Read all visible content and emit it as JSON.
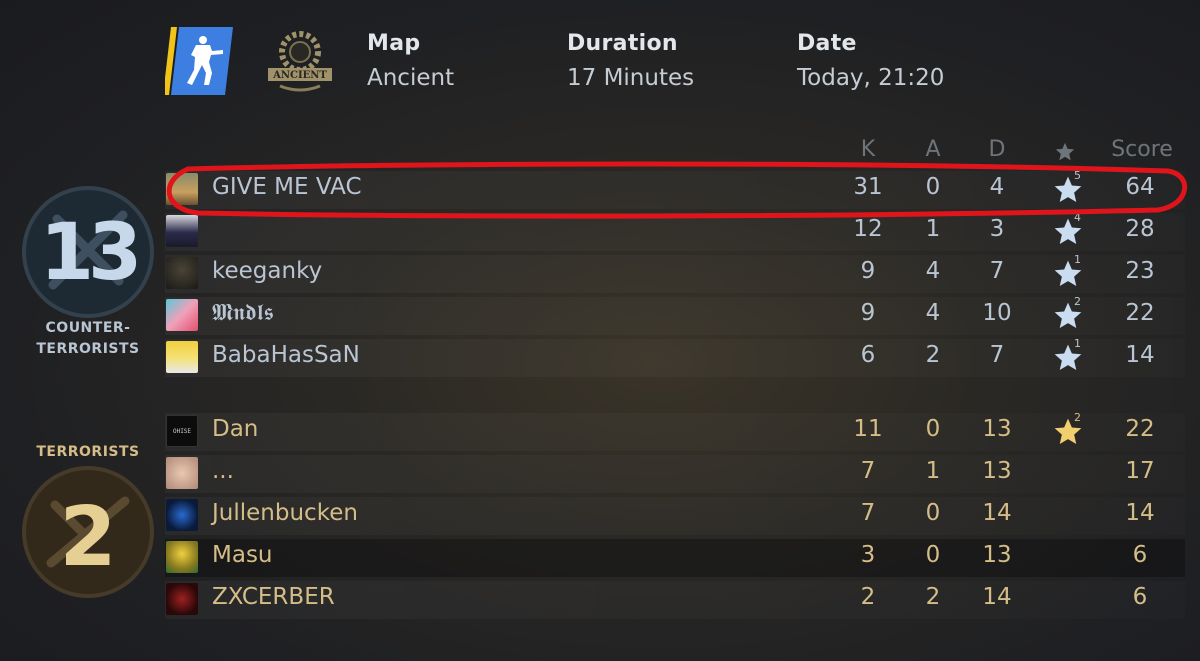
{
  "header": {
    "mode_icon": "gun-silhouette-icon",
    "map_icon": "ancient-map-icon",
    "map_icon_text": "ANCIENT",
    "map_label": "Map",
    "map_value": "Ancient",
    "duration_label": "Duration",
    "duration_value": "17 Minutes",
    "date_label": "Date",
    "date_value": "Today, 21:20"
  },
  "columns": {
    "k": "K",
    "a": "A",
    "d": "D",
    "mvp_icon": "star-icon",
    "score": "Score"
  },
  "teams": {
    "ct": {
      "name": "COUNTER-\nTERRORISTS",
      "score": "13",
      "color": "#b9c5d2"
    },
    "t": {
      "name": "TERRORISTS",
      "score": "2",
      "color": "#d5bd88"
    }
  },
  "ct_players": [
    {
      "name": "GIVE ME VAC",
      "k": "31",
      "a": "0",
      "d": "4",
      "mvp": "5",
      "score": "64"
    },
    {
      "name": "",
      "k": "12",
      "a": "1",
      "d": "3",
      "mvp": "4",
      "score": "28"
    },
    {
      "name": "keeganky",
      "k": "9",
      "a": "4",
      "d": "7",
      "mvp": "1",
      "score": "23"
    },
    {
      "name": "𝕸𝖓𝖉𝖑𝖘",
      "k": "9",
      "a": "4",
      "d": "10",
      "mvp": "2",
      "score": "22"
    },
    {
      "name": "BabaHasSaN",
      "k": "6",
      "a": "2",
      "d": "7",
      "mvp": "1",
      "score": "14"
    }
  ],
  "t_players": [
    {
      "name": "Dan",
      "avatar_text": "OHISE",
      "k": "11",
      "a": "0",
      "d": "13",
      "mvp": "2",
      "score": "22"
    },
    {
      "name": "...",
      "k": "7",
      "a": "1",
      "d": "13",
      "mvp": "",
      "score": "17"
    },
    {
      "name": "Jullenbucken",
      "k": "7",
      "a": "0",
      "d": "14",
      "mvp": "",
      "score": "14"
    },
    {
      "name": "Masu",
      "k": "3",
      "a": "0",
      "d": "13",
      "mvp": "",
      "score": "6"
    },
    {
      "name": "ZXCERBER",
      "k": "2",
      "a": "2",
      "d": "14",
      "mvp": "",
      "score": "6"
    }
  ],
  "annotation": {
    "color": "#e0141b",
    "shape": "hand-drawn-ellipse"
  }
}
